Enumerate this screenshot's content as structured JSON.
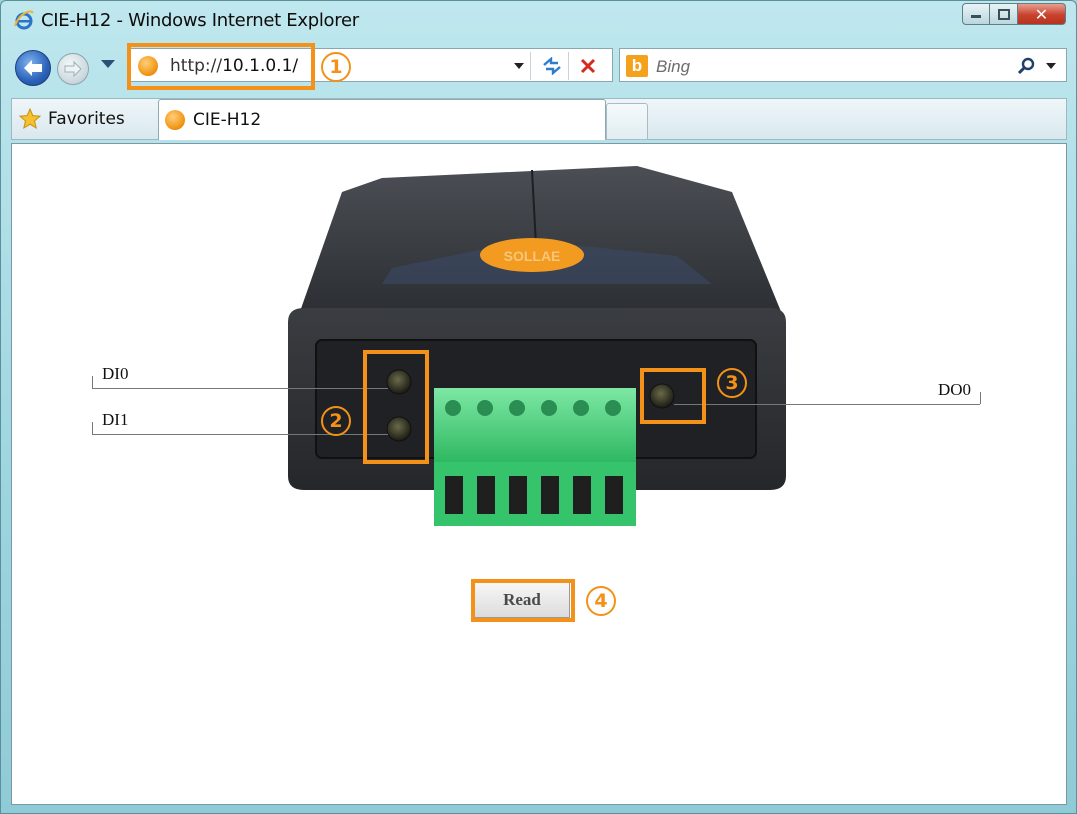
{
  "window": {
    "title": "CIE-H12 - Windows Internet Explorer",
    "minimize": "—",
    "maximize": "▫",
    "close": "✕"
  },
  "navbar": {
    "url_prefix": "http://",
    "url_host": "10.1.0.1/",
    "search_placeholder": "Bing",
    "bing_letter": "b"
  },
  "favorites": {
    "label": "Favorites"
  },
  "tab": {
    "label": "CIE-H12"
  },
  "device": {
    "labels": {
      "di0": "DI0",
      "di1": "DI1",
      "do0": "DO0"
    },
    "read_button": "Read"
  },
  "callouts": {
    "c1": "1",
    "c2": "2",
    "c3": "3",
    "c4": "4"
  },
  "colors": {
    "highlight": "#f39119",
    "terminal_green": "#3fce7a",
    "device_body": "#2e3134"
  }
}
